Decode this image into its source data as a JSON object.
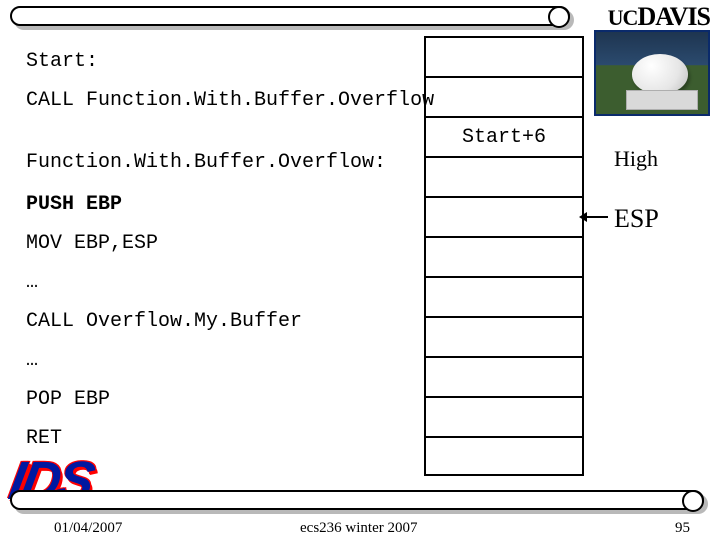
{
  "brand": {
    "uc": "UC",
    "davis": "DAVIS"
  },
  "code": {
    "l1": "Start:",
    "l2": "CALL Function.With.Buffer.Overflow",
    "l3": "Function.With.Buffer.Overflow:",
    "l4": "PUSH EBP",
    "l5": "MOV EBP,ESP",
    "l6": "…",
    "l7": "CALL Overflow.My.Buffer",
    "l8": "…",
    "l9": "POP EBP",
    "l10": "RET"
  },
  "stack": {
    "cells": [
      "",
      "",
      "Start+6",
      "",
      "",
      "",
      "",
      "",
      "",
      "",
      ""
    ]
  },
  "labels": {
    "high": "High",
    "esp": "ESP"
  },
  "badge": "IDS",
  "footer": {
    "date": "01/04/2007",
    "center": "ecs236 winter 2007",
    "page": "95"
  }
}
